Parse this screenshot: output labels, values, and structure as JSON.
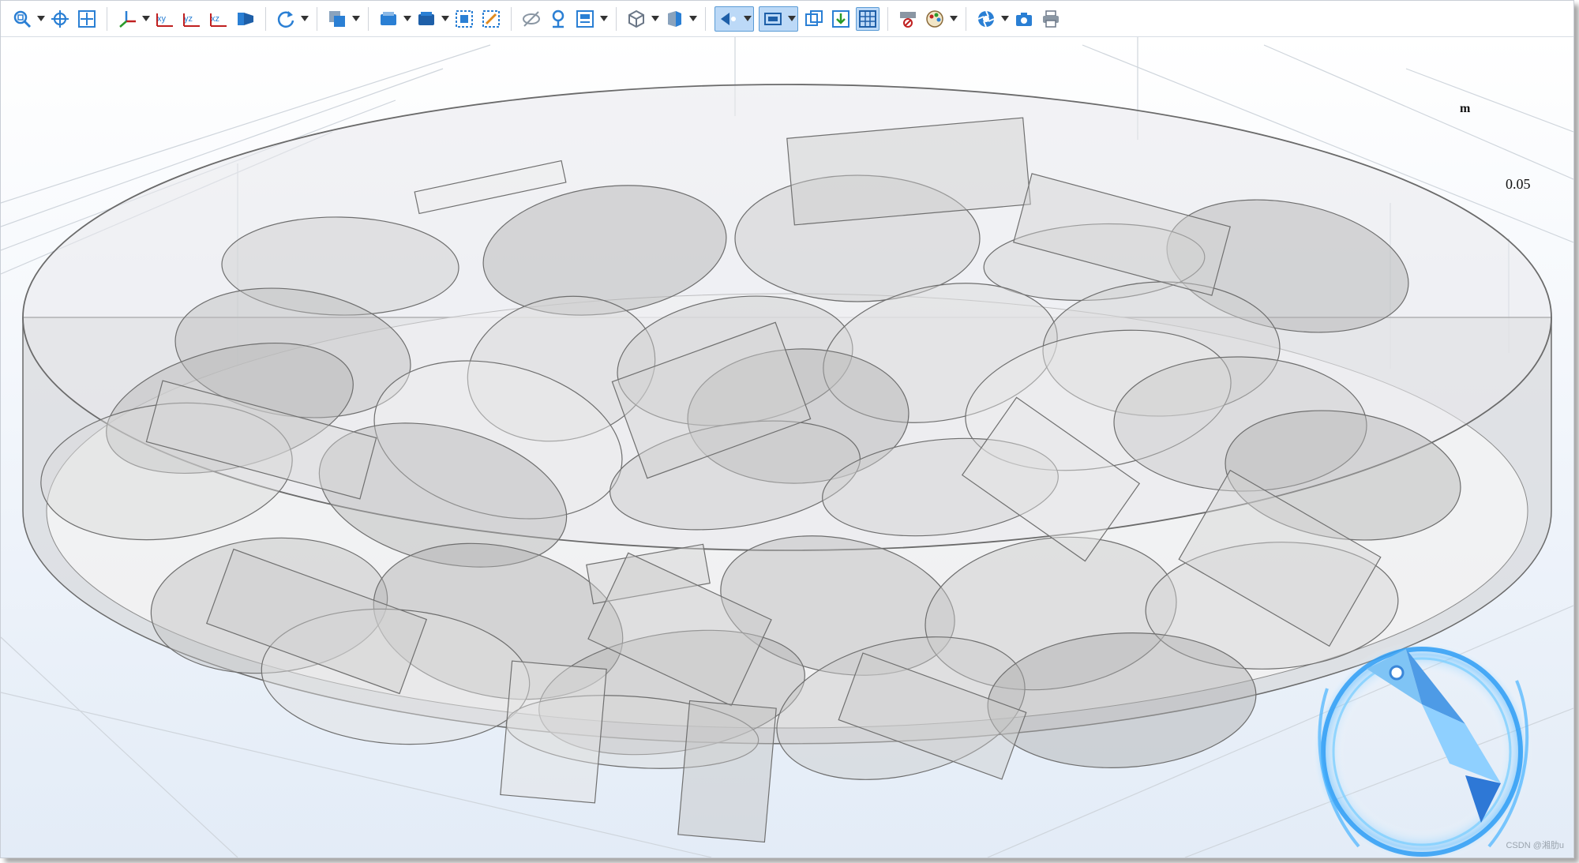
{
  "toolbar": {
    "buttons": [
      {
        "name": "zoom-box-icon",
        "dropdown": true
      },
      {
        "name": "zoom-in-icon",
        "dropdown": false
      },
      {
        "name": "zoom-extents-icon",
        "dropdown": false
      },
      {
        "name": "axis-orientation-icon",
        "dropdown": true
      },
      {
        "name": "xy-view-icon",
        "label": "XY"
      },
      {
        "name": "yz-view-icon",
        "label": "YZ"
      },
      {
        "name": "xz-view-icon",
        "label": "XZ"
      },
      {
        "name": "render-view-icon",
        "dropdown": false
      },
      {
        "name": "rotate-icon",
        "dropdown": true
      },
      {
        "name": "copy-view-icon",
        "dropdown": true
      },
      {
        "name": "select-box-icon",
        "dropdown": true
      },
      {
        "name": "select-all-icon",
        "dropdown": true
      },
      {
        "name": "zoom-select-icon",
        "dropdown": false
      },
      {
        "name": "select-edges-icon",
        "dropdown": false
      },
      {
        "name": "hide-icon",
        "dropdown": false
      },
      {
        "name": "reset-hiding-icon",
        "dropdown": false
      },
      {
        "name": "view-settings-icon",
        "dropdown": true
      },
      {
        "name": "wireframe-icon",
        "dropdown": true
      },
      {
        "name": "transparency-icon",
        "dropdown": true
      },
      {
        "name": "lighting-icon",
        "dropdown": true,
        "active": true
      },
      {
        "name": "render-mode-icon",
        "dropdown": true,
        "active": true
      },
      {
        "name": "scene-light-icon",
        "dropdown": false
      },
      {
        "name": "import-icon",
        "dropdown": false
      },
      {
        "name": "grid-icon",
        "dropdown": false,
        "active": true
      },
      {
        "name": "clear-selection-icon",
        "dropdown": false
      },
      {
        "name": "color-table-icon",
        "dropdown": true
      },
      {
        "name": "aperture-icon",
        "dropdown": true
      },
      {
        "name": "camera-icon",
        "dropdown": false
      },
      {
        "name": "print-icon",
        "dropdown": false
      }
    ]
  },
  "viewport": {
    "unit_label": "m",
    "tick_label": "0.05",
    "watermark": "CSDN @湘肋u"
  },
  "colors": {
    "accent": "#2a7fd4",
    "active_button": "#bcd9f7",
    "geometry_fill": "#b4b4b4",
    "geometry_stroke": "#6a6a6a",
    "logo": "#3a9cf0"
  }
}
